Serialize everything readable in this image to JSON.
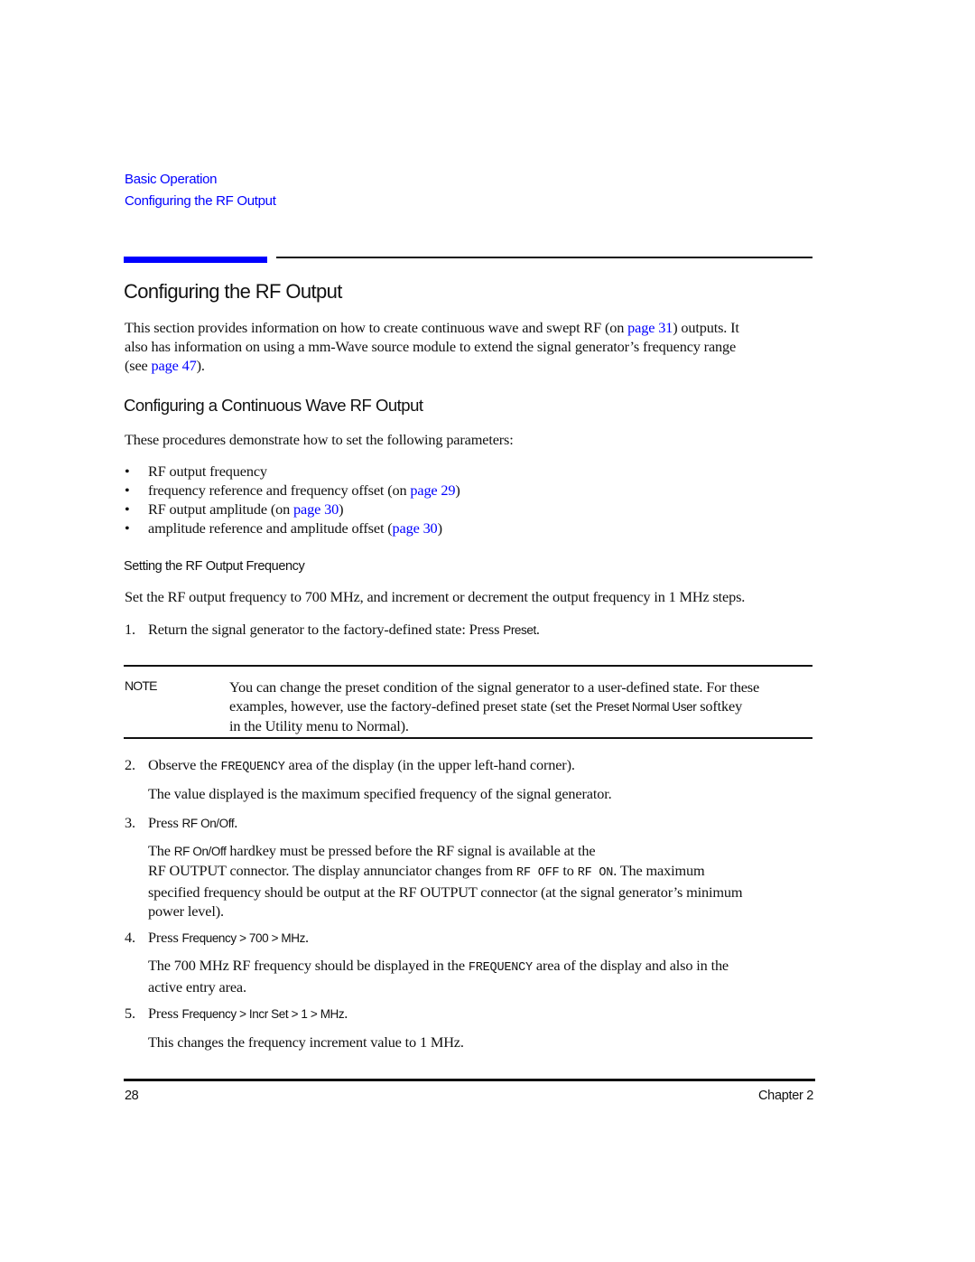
{
  "breadcrumb": {
    "section": "Basic Operation",
    "subsection": "Configuring the RF Output"
  },
  "colors": {
    "accent": "#0000ff",
    "text": "#111111"
  },
  "main": {
    "title": "Configuring the RF Output",
    "intro": {
      "part1": "This section provides information on how to create continuous wave and swept RF (on ",
      "link1": "page 31",
      "part2": ") outputs. It",
      "line2": "also has information on using a mm-Wave source module to extend the signal generator’s frequency range",
      "line3_pre": "(see ",
      "link2": "page 47",
      "line3_post": ")."
    },
    "cw_section": {
      "heading": "Configuring a Continuous Wave RF Output",
      "lead": "These procedures demonstrate how to set the following parameters:",
      "bullets": [
        {
          "text": "RF output frequency",
          "pre": "",
          "link": "",
          "post": ""
        },
        {
          "text": "frequency reference and frequency offset (on ",
          "link": "page 29",
          "post": ")"
        },
        {
          "text": "RF output amplitude (on ",
          "link": "page 30",
          "post": ")"
        },
        {
          "text": "amplitude reference and amplitude offset (",
          "link": "page 30",
          "post": ")"
        }
      ],
      "bullet_glyph": "•"
    },
    "freq_section": {
      "heading": "Setting the RF Output Frequency",
      "lead": "Set the RF output frequency to 700 MHz, and increment or decrement the output frequency in 1 MHz steps.",
      "step1": {
        "num": "1.",
        "text": "Return the signal generator to the factory-defined state: Press ",
        "key": "Preset",
        "post": "."
      },
      "note": {
        "label": "NOTE",
        "line1": "You can change the preset condition of the signal generator to a user-defined state. For these",
        "line2_pre": "examples, however, use the factory-defined preset state (set the ",
        "line2_key": "Preset Normal User",
        "line2_post": " softkey",
        "line3": "in the Utility menu to Normal)."
      },
      "step2": {
        "num": "2.",
        "pre": "Observe the ",
        "code": "FREQUENCY",
        "post": " area of the display (in the upper left-hand corner).",
        "detail": "The value displayed is the maximum specified frequency of the signal generator."
      },
      "step3": {
        "num": "3.",
        "pre": "Press ",
        "key": "RF On/Off",
        "post": ".",
        "detail_l1_pre": "The ",
        "detail_l1_key": "RF On/Off",
        "detail_l1_post": " hardkey must be pressed before the RF signal is available at the",
        "detail_l2_pre": "RF OUTPUT connector. The display annunciator changes from ",
        "detail_l2_code1": "RF OFF",
        "detail_l2_mid": " to ",
        "detail_l2_code2": "RF ON",
        "detail_l2_post": ". The maximum",
        "detail_l3": "specified frequency should be output at the RF OUTPUT connector (at the signal generator’s minimum",
        "detail_l4": "power level)."
      },
      "step4": {
        "num": "4.",
        "pre": "Press ",
        "key": "Frequency > 700 > MHz",
        "post": ".",
        "detail_l1_pre": "The 700 MHz RF frequency should be displayed in the ",
        "detail_l1_code": "FREQUENCY",
        "detail_l1_post": " area of the display and also in the",
        "detail_l2": "active entry area."
      },
      "step5": {
        "num": "5.",
        "pre": "Press ",
        "key": "Frequency > Incr Set > 1 > MHz",
        "post": ".",
        "detail": "This changes the frequency increment value to 1 MHz."
      }
    }
  },
  "footer": {
    "page_number": "28",
    "chapter": "Chapter 2"
  }
}
